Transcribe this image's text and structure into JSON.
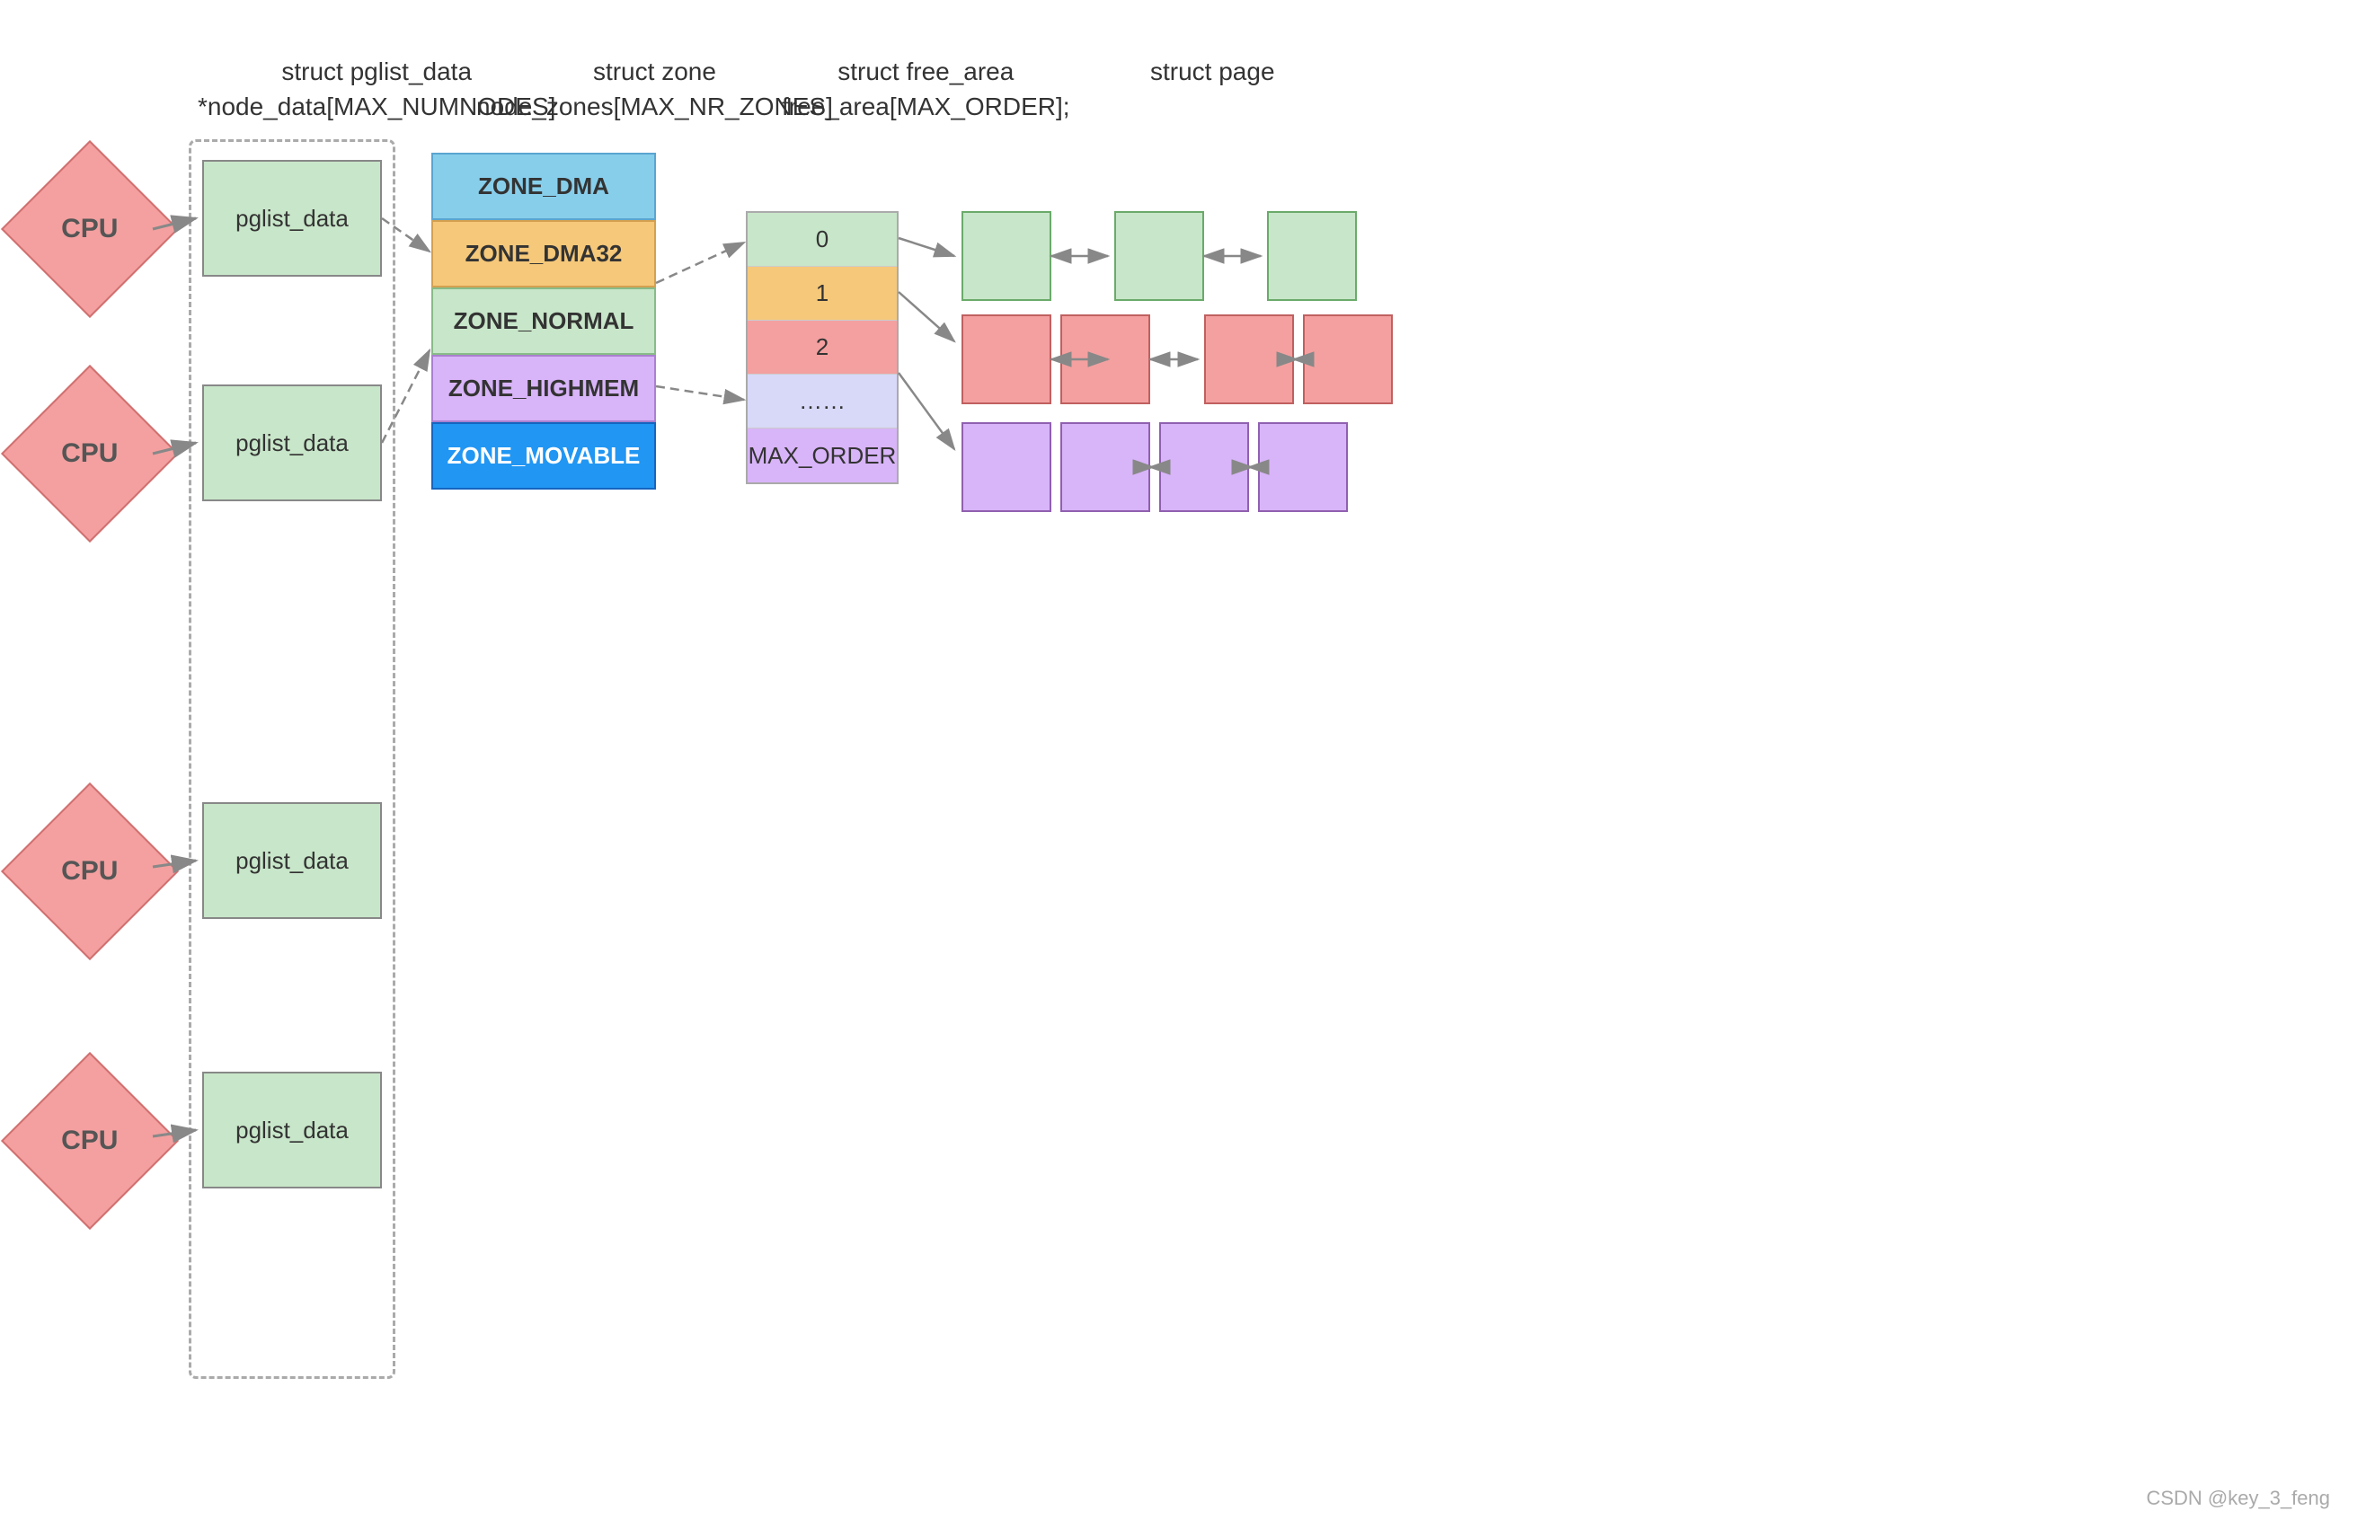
{
  "header": {
    "col1_line1": "struct pglist_data",
    "col1_line2": "*node_data[MAX_NUMNODES]",
    "col2_line1": "struct zone",
    "col2_line2": "node_zones[MAX_NR_ZONES]",
    "col3_line1": "struct free_area",
    "col3_line2": "free_area[MAX_ORDER];",
    "col4_line1": "struct page"
  },
  "cpus": [
    "CPU",
    "CPU",
    "CPU",
    "CPU"
  ],
  "pglist_label": "pglist_data",
  "zones": [
    {
      "label": "ZONE_DMA",
      "bg": "#87CEEB",
      "border": "#5aa5d0"
    },
    {
      "label": "ZONE_DMA32",
      "bg": "#f5c87a",
      "border": "#d4a050"
    },
    {
      "label": "ZONE_NORMAL",
      "bg": "#c8e6c9",
      "border": "#88bb88"
    },
    {
      "label": "ZONE_HIGHMEM",
      "bg": "#d8b4f8",
      "border": "#aa80d0"
    },
    {
      "label": "ZONE_MOVABLE",
      "bg": "#2196F3",
      "border": "#1565C0"
    }
  ],
  "free_area_rows": [
    "0",
    "1",
    "2",
    "……",
    "MAX_ORDER"
  ],
  "page_groups": [
    {
      "color": "#c8e6c9",
      "border": "#6aaa6a",
      "count": 3
    },
    {
      "color": "#f4a0a0",
      "border": "#c06060",
      "count": 4
    },
    {
      "color": "#d8b4f8",
      "border": "#9060b0",
      "count": 4
    }
  ],
  "watermark": "CSDN @key_3_feng"
}
